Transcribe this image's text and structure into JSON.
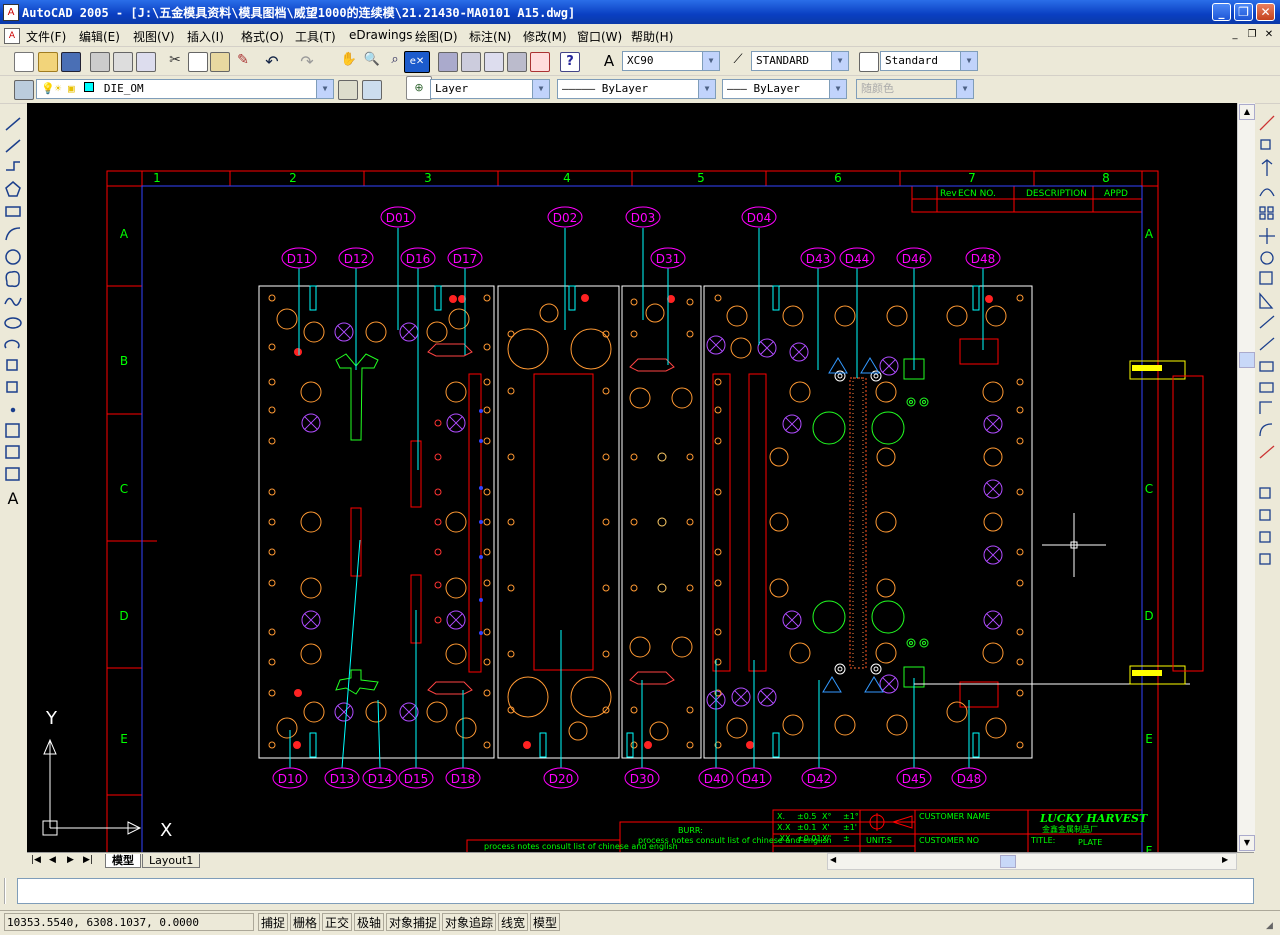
{
  "window": {
    "title": "AutoCAD 2005 - [J:\\五金模具资料\\模具图档\\威望1000的连续模\\21.21430-MA0101 A15.dwg]",
    "app_icon": "autocad-icon",
    "controls": [
      "minimize",
      "maximize",
      "close"
    ]
  },
  "menu": {
    "items": [
      "文件(F)",
      "编辑(E)",
      "视图(V)",
      "插入(I)",
      "格式(O)",
      "工具(T)",
      "eDrawings",
      "绘图(D)",
      "标注(N)",
      "修改(M)",
      "窗口(W)",
      "帮助(H)"
    ]
  },
  "toolbar": {
    "text_style": "XC90",
    "dim_style": "STANDARD",
    "table_style": "Standard",
    "layer": "DIE_OM",
    "layer_control": "Layer",
    "linetype": "ByLayer",
    "lineweight": "ByLayer",
    "plot_style": "随颜色"
  },
  "drawing": {
    "column_numbers": [
      "1",
      "2",
      "3",
      "4",
      "5",
      "6",
      "7",
      "8"
    ],
    "row_letters": [
      "A",
      "B",
      "C",
      "D",
      "E"
    ],
    "bottom_row_letter": "F",
    "revision_header": [
      "Rev",
      "ECN NO.",
      "DESCRIPTION",
      "APPD"
    ],
    "top_labels": [
      "D01",
      "D02",
      "D03",
      "D04",
      "D11",
      "D12",
      "D16",
      "D17",
      "D31",
      "D43",
      "D44",
      "D46",
      "D48"
    ],
    "bottom_labels": [
      "D10",
      "D13",
      "D14",
      "D15",
      "D18",
      "D20",
      "D30",
      "D40",
      "D41",
      "D42",
      "D45",
      "D48"
    ],
    "title_block": {
      "company": "LUCKY HARVEST",
      "company_cn": "金鑫金属制品厂",
      "customer_name_label": "CUSTOMER NAME",
      "customer_no_label": "CUSTOMER NO",
      "title_label": "TITLE:",
      "title_value": "PLATE",
      "burr_label": "BURR:",
      "unit_label": "UNIT:S",
      "note": "process notes consult list of chinese and english",
      "tolerances": [
        [
          "X.",
          "±0.5",
          "X°",
          "±1°"
        ],
        [
          "X.X",
          "±0.1",
          "X'",
          "±1'"
        ],
        [
          ".XX",
          "±0.01",
          "X\"",
          "±"
        ]
      ]
    },
    "ucs": {
      "x": "X",
      "y": "Y"
    }
  },
  "tabs": [
    "模型",
    "Layout1"
  ],
  "status": {
    "coords": "10353.5540,  6308.1037,  0.0000",
    "toggles": [
      "捕捉",
      "栅格",
      "正交",
      "极轴",
      "对象捕捉",
      "对象追踪",
      "线宽",
      "模型"
    ]
  },
  "colors": {
    "titlebar": "#0a3fc2",
    "canvas": "#000000",
    "frame": "#ff0000",
    "labels": "#ff00ff",
    "grid_text": "#00ff00",
    "leaders": "#00ffff"
  }
}
